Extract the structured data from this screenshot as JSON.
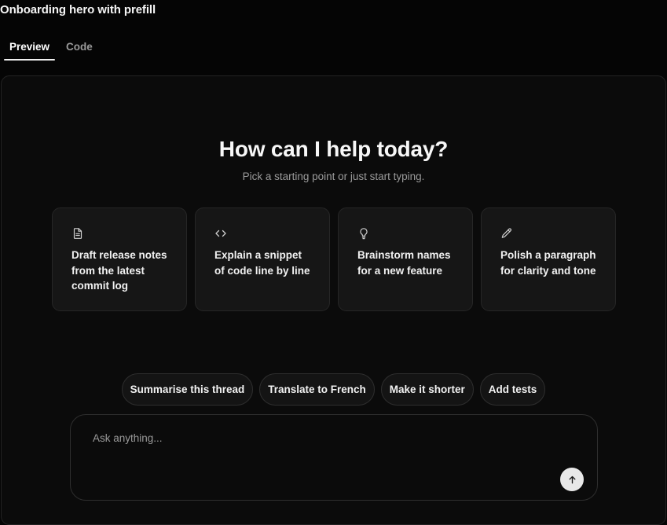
{
  "page": {
    "title": "Onboarding hero with prefill"
  },
  "tabs": [
    {
      "label": "Preview",
      "active": true
    },
    {
      "label": "Code",
      "active": false
    }
  ],
  "hero": {
    "title": "How can I help today?",
    "subtitle": "Pick a starting point or just start typing."
  },
  "cards": [
    {
      "icon": "document-icon",
      "text": "Draft release notes from the latest commit log"
    },
    {
      "icon": "code-icon",
      "text": "Explain a snippet of code line by line"
    },
    {
      "icon": "lightbulb-icon",
      "text": "Brainstorm names for a new feature"
    },
    {
      "icon": "pencil-icon",
      "text": "Polish a paragraph for clarity and tone"
    }
  ],
  "chips": [
    {
      "label": "Summarise this thread"
    },
    {
      "label": "Translate to French"
    },
    {
      "label": "Make it shorter"
    },
    {
      "label": "Add tests"
    }
  ],
  "composer": {
    "placeholder": "Ask anything...",
    "value": "",
    "send_icon": "arrow-up-icon"
  },
  "colors": {
    "background": "#050505",
    "panel": "#0b0b0b",
    "card": "#161616",
    "text": "#f2f2f2",
    "muted": "#9b9b9b",
    "send_button": "#e8e8e8"
  }
}
